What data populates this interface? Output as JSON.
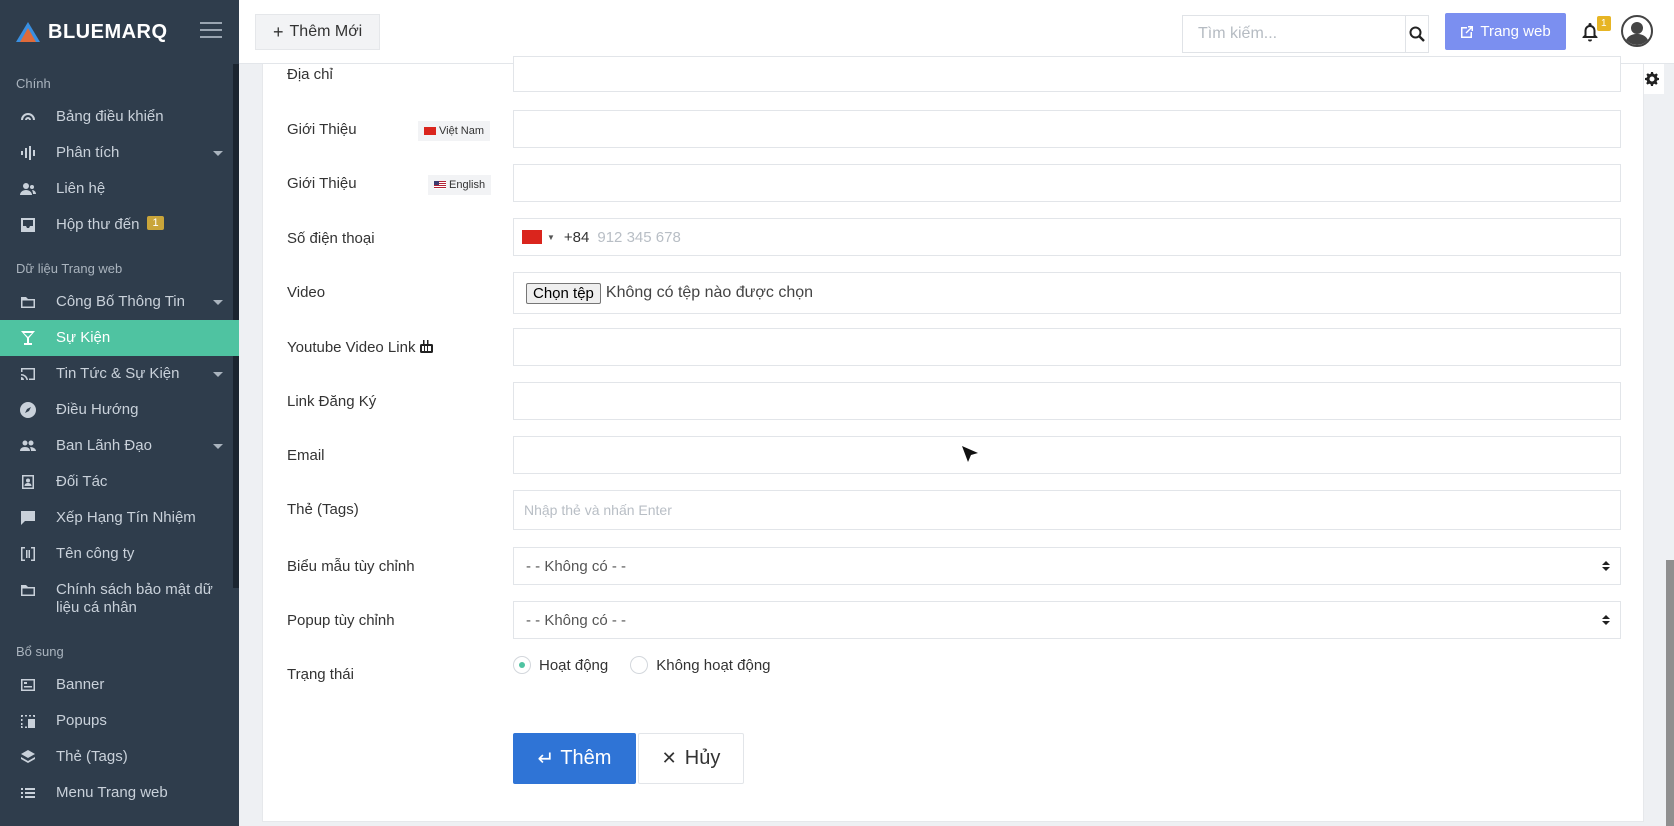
{
  "brand": {
    "name": "BLUEMARQ"
  },
  "sidebar": {
    "section_main": "Chính",
    "section_web": "Dữ liệu Trang web",
    "section_extra": "Bổ sung",
    "items_main": [
      {
        "label": "Bảng điều khiển",
        "icon": "gauge-icon"
      },
      {
        "label": "Phân tích",
        "icon": "waveform-icon"
      },
      {
        "label": "Liên hệ",
        "icon": "users-icon"
      },
      {
        "label": "Hộp thư đến",
        "icon": "inbox-icon",
        "badge": "1"
      }
    ],
    "items_web": [
      {
        "label": "Công Bố Thông Tin",
        "icon": "folder-icon"
      },
      {
        "label": "Sự Kiện",
        "icon": "trophy-icon"
      },
      {
        "label": "Tin Tức & Sự Kiện",
        "icon": "cast-icon"
      },
      {
        "label": "Điều Hướng",
        "icon": "compass-icon"
      },
      {
        "label": "Ban Lãnh Đạo",
        "icon": "team-icon"
      },
      {
        "label": "Đối Tác",
        "icon": "contact-card-icon"
      },
      {
        "label": "Xếp Hạng Tín Nhiệm",
        "icon": "rating-icon"
      },
      {
        "label": "Tên công ty",
        "icon": "company-icon"
      },
      {
        "label": "Chính sách bảo mật dữ liệu cá nhân",
        "icon": "folder-icon"
      }
    ],
    "items_extra": [
      {
        "label": "Banner",
        "icon": "banner-icon"
      },
      {
        "label": "Popups",
        "icon": "popup-icon"
      },
      {
        "label": "Thẻ (Tags)",
        "icon": "layers-icon"
      },
      {
        "label": "Menu Trang web",
        "icon": "list-icon"
      }
    ]
  },
  "topbar": {
    "add_label": "Thêm Mới",
    "search_placeholder": "Tìm kiếm...",
    "web_label": "Trang web",
    "notif_count": "1"
  },
  "form": {
    "address_label": "Địa chỉ",
    "intro_label": "Giới Thiệu",
    "lang_vn": "Việt Nam",
    "lang_en": "English",
    "phone_label": "Số điện thoại",
    "phone_code": "+84",
    "phone_placeholder": "912 345 678",
    "video_label": "Video",
    "file_button": "Chọn tệp",
    "file_status": "Không có tệp nào được chọn",
    "youtube_label": "Youtube Video Link",
    "register_label": "Link Đăng Ký",
    "email_label": "Email",
    "tags_label": "Thẻ (Tags)",
    "tags_placeholder": "Nhập thẻ và nhấn Enter",
    "custom_form_label": "Biểu mẫu tùy chỉnh",
    "custom_form_value": "- - Không có - -",
    "custom_popup_label": "Popup tùy chỉnh",
    "custom_popup_value": "- - Không có - -",
    "status_label": "Trạng thái",
    "status_active": "Hoạt động",
    "status_inactive": "Không hoạt động",
    "submit_label": "Thêm",
    "cancel_label": "Hủy"
  },
  "colors": {
    "sidebar_bg": "#2f3d4c",
    "active_item": "#4fc3a1",
    "primary": "#2f74d6",
    "web_button": "#7b8ff0",
    "badge": "#e7b524"
  }
}
